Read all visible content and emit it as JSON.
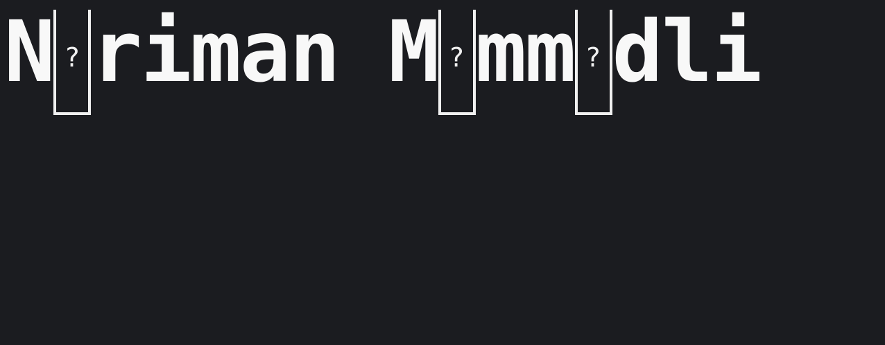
{
  "title_parts": {
    "p1": "N",
    "p2": "riman M",
    "p3": "mm",
    "p4": "dli"
  },
  "missing_glyph_mark": "?",
  "colors": {
    "background": "#1b1c20",
    "text": "#f8f8f8",
    "glyph_box": "#f0f0f0"
  }
}
